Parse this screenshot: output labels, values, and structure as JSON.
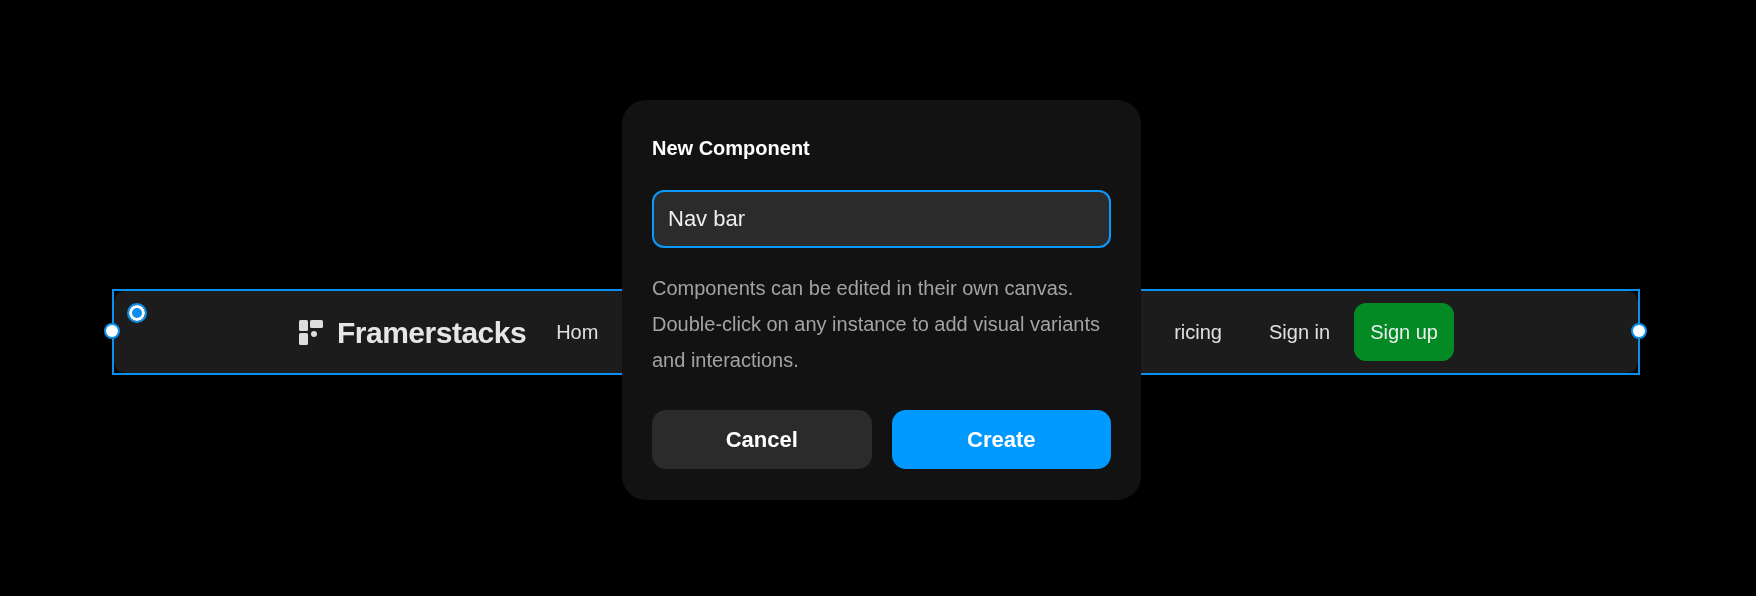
{
  "canvas": {
    "navbar": {
      "selected": true,
      "logo": "Framerstacks",
      "links": [
        "Hom",
        "ricing"
      ],
      "sign_in": "Sign in",
      "sign_up": "Sign up"
    }
  },
  "dialog": {
    "title": "New Component",
    "name_field": {
      "value": "Nav bar",
      "focused": true
    },
    "description": "Components can be edited in their own canvas. Double-click on any instance to add visual variants and interactions.",
    "buttons": [
      {
        "label": "Cancel",
        "kind": "secondary"
      },
      {
        "label": "Create",
        "kind": "primary"
      }
    ]
  }
}
